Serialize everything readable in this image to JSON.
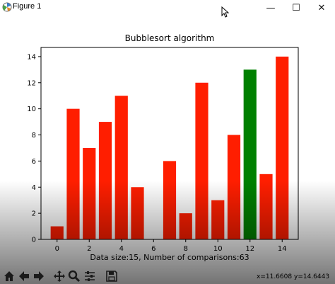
{
  "window": {
    "title": "Figure 1",
    "minimize_label": "—",
    "maximize_label": "☐",
    "close_label": "✕"
  },
  "toolbar": {
    "tools": [
      {
        "name": "home-icon"
      },
      {
        "name": "back-arrow-icon"
      },
      {
        "name": "forward-arrow-icon"
      },
      {
        "name": "pan-icon"
      },
      {
        "name": "zoom-icon"
      },
      {
        "name": "configure-subplots-icon"
      },
      {
        "name": "save-icon"
      }
    ],
    "coord_x": "x=11.6608",
    "coord_y": "y=14.6443"
  },
  "chart_data": {
    "type": "bar",
    "title": "Bubblesort algorithm",
    "xlabel": "Data size:15, Number of comparisons:63",
    "ylabel": "",
    "x": [
      0,
      1,
      2,
      3,
      4,
      5,
      6,
      7,
      8,
      9,
      10,
      11,
      12,
      13,
      14
    ],
    "values": [
      1,
      10,
      7,
      9,
      11,
      4,
      0,
      6,
      2,
      12,
      3,
      8,
      13,
      5,
      14
    ],
    "colors": [
      "#ff1e00",
      "#ff1e00",
      "#ff1e00",
      "#ff1e00",
      "#ff1e00",
      "#ff1e00",
      "#ff1e00",
      "#ff1e00",
      "#ff1e00",
      "#ff1e00",
      "#ff1e00",
      "#ff1e00",
      "#008000",
      "#ff1e00",
      "#ff1e00"
    ],
    "highlight_color": "#008000",
    "bar_color": "#ff1e00",
    "xlim": [
      -1,
      15
    ],
    "ylim": [
      0,
      14.7
    ],
    "xticks": [
      0,
      2,
      4,
      6,
      8,
      10,
      12,
      14
    ],
    "yticks": [
      0,
      2,
      4,
      6,
      8,
      10,
      12,
      14
    ],
    "grid": false,
    "legend": "none"
  }
}
